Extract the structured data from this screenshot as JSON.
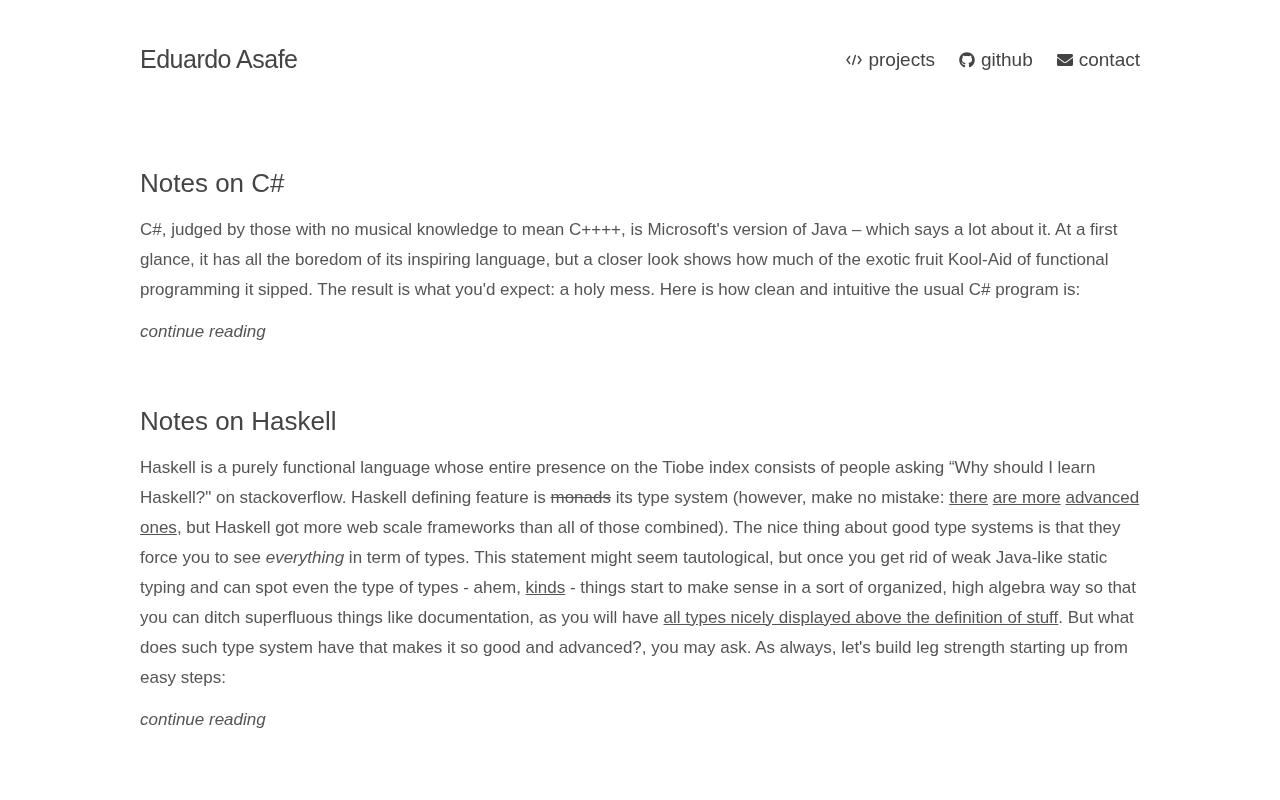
{
  "header": {
    "site_title": "Eduardo Asafe",
    "nav": [
      {
        "kind": "code",
        "label": "projects"
      },
      {
        "kind": "github",
        "label": "github"
      },
      {
        "kind": "mail",
        "label": "contact"
      }
    ]
  },
  "posts": [
    {
      "title": "Notes on C#",
      "excerpt": [
        {
          "kind": "text",
          "text": "C#, judged by those with no musical knowledge to mean C++++, is Microsoft's version of Java – which says a lot about it. At a first glance, it has all the boredom of its inspiring language, but a closer look shows how much of the exotic fruit Kool-Aid of functional programming it sipped. The result is what you'd expect: a holy mess. Here is how clean and intuitive the usual C# program is:"
        }
      ],
      "more": "continue reading"
    },
    {
      "title": "Notes on Haskell",
      "excerpt": [
        {
          "kind": "text",
          "text": "Haskell is a purely functional language whose entire presence on the Tiobe index consists of people asking “Why should I learn Haskell?\" on stackoverflow. Haskell defining feature is "
        },
        {
          "kind": "strike",
          "text": "monads"
        },
        {
          "kind": "text",
          "text": " its type system (however, make no mistake: "
        },
        {
          "kind": "links",
          "items": [
            "there",
            "are more",
            "advanced",
            "ones"
          ]
        },
        {
          "kind": "text",
          "text": ", but Haskell got more web scale frameworks than all of those combined). The nice thing about good type systems is that they force you to see "
        },
        {
          "kind": "em",
          "text": "everything"
        },
        {
          "kind": "text",
          "text": " in term of types. This statement might seem tautological, but once you get rid of weak Java-like static typing and can spot even the type of types - ahem, "
        },
        {
          "kind": "link",
          "text": "kinds"
        },
        {
          "kind": "text",
          "text": " - things start to make sense in a sort of organized, high algebra way so that you can ditch superfluous things like documentation, as you will have "
        },
        {
          "kind": "link",
          "text": "all types nicely displayed above the definition of stuff"
        },
        {
          "kind": "text",
          "text": ". But what does such type system have that makes it so good and advanced?, you may ask. As always, let's build leg strength starting up from easy steps:"
        }
      ],
      "more": "continue reading"
    }
  ]
}
